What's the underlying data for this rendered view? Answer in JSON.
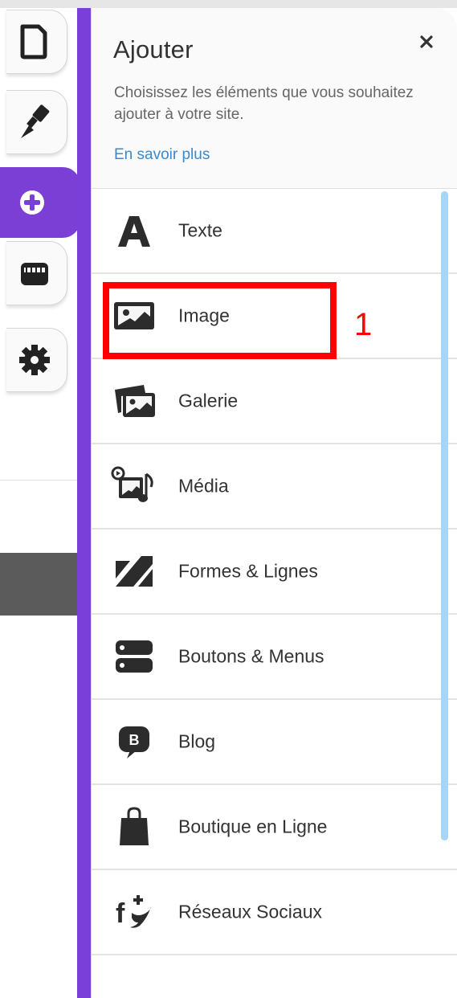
{
  "rail": {
    "tabs": [
      {
        "id": "pages",
        "icon": "page-icon",
        "active": false
      },
      {
        "id": "design",
        "icon": "paint-brush-icon",
        "active": false
      },
      {
        "id": "add",
        "icon": "plus-circle-icon",
        "active": true
      },
      {
        "id": "apps",
        "icon": "store-icon",
        "active": false
      },
      {
        "id": "settings",
        "icon": "gear-icon",
        "active": false
      }
    ]
  },
  "panel": {
    "title": "Ajouter",
    "description": "Choisissez les éléments que vous souhaitez ajouter à votre site.",
    "learn_more": "En savoir plus",
    "close_icon": "close-icon",
    "items": [
      {
        "label": "Texte",
        "icon": "text-icon"
      },
      {
        "label": "Image",
        "icon": "image-icon"
      },
      {
        "label": "Galerie",
        "icon": "gallery-icon"
      },
      {
        "label": "Média",
        "icon": "media-icon"
      },
      {
        "label": "Formes & Lignes",
        "icon": "shapes-icon"
      },
      {
        "label": "Boutons & Menus",
        "icon": "buttons-menus-icon"
      },
      {
        "label": "Blog",
        "icon": "blog-icon"
      },
      {
        "label": "Boutique en Ligne",
        "icon": "shopping-bag-icon"
      },
      {
        "label": "Réseaux Sociaux",
        "icon": "social-icon"
      }
    ]
  },
  "annotation": {
    "number": "1"
  },
  "colors": {
    "accent": "#7a3fd8",
    "link": "#3b89c9",
    "highlight": "#ff0000",
    "scrollbar": "#a7d5f8"
  }
}
